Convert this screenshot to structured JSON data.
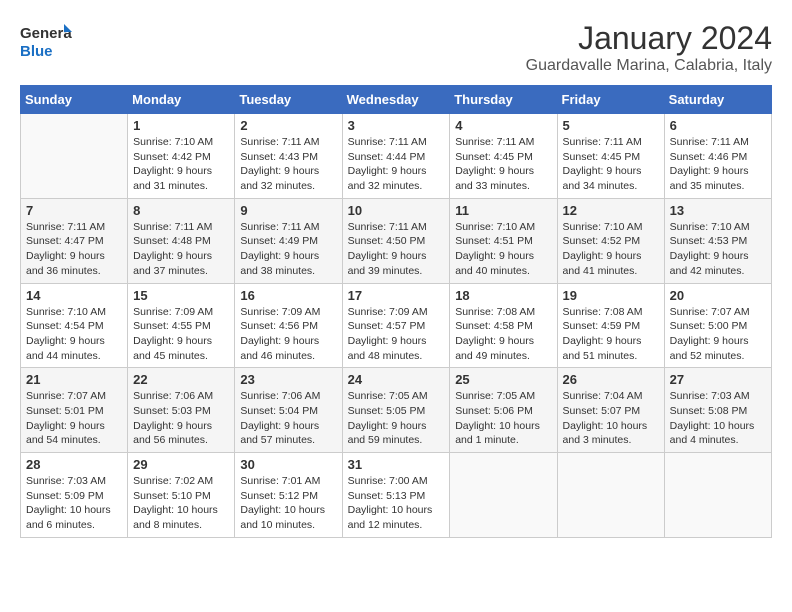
{
  "logo": {
    "general": "General",
    "blue": "Blue"
  },
  "header": {
    "month": "January 2024",
    "location": "Guardavalle Marina, Calabria, Italy"
  },
  "weekdays": [
    "Sunday",
    "Monday",
    "Tuesday",
    "Wednesday",
    "Thursday",
    "Friday",
    "Saturday"
  ],
  "weeks": [
    [
      {
        "day": "",
        "info": ""
      },
      {
        "day": "1",
        "info": "Sunrise: 7:10 AM\nSunset: 4:42 PM\nDaylight: 9 hours\nand 31 minutes."
      },
      {
        "day": "2",
        "info": "Sunrise: 7:11 AM\nSunset: 4:43 PM\nDaylight: 9 hours\nand 32 minutes."
      },
      {
        "day": "3",
        "info": "Sunrise: 7:11 AM\nSunset: 4:44 PM\nDaylight: 9 hours\nand 32 minutes."
      },
      {
        "day": "4",
        "info": "Sunrise: 7:11 AM\nSunset: 4:45 PM\nDaylight: 9 hours\nand 33 minutes."
      },
      {
        "day": "5",
        "info": "Sunrise: 7:11 AM\nSunset: 4:45 PM\nDaylight: 9 hours\nand 34 minutes."
      },
      {
        "day": "6",
        "info": "Sunrise: 7:11 AM\nSunset: 4:46 PM\nDaylight: 9 hours\nand 35 minutes."
      }
    ],
    [
      {
        "day": "7",
        "info": "Sunrise: 7:11 AM\nSunset: 4:47 PM\nDaylight: 9 hours\nand 36 minutes."
      },
      {
        "day": "8",
        "info": "Sunrise: 7:11 AM\nSunset: 4:48 PM\nDaylight: 9 hours\nand 37 minutes."
      },
      {
        "day": "9",
        "info": "Sunrise: 7:11 AM\nSunset: 4:49 PM\nDaylight: 9 hours\nand 38 minutes."
      },
      {
        "day": "10",
        "info": "Sunrise: 7:11 AM\nSunset: 4:50 PM\nDaylight: 9 hours\nand 39 minutes."
      },
      {
        "day": "11",
        "info": "Sunrise: 7:10 AM\nSunset: 4:51 PM\nDaylight: 9 hours\nand 40 minutes."
      },
      {
        "day": "12",
        "info": "Sunrise: 7:10 AM\nSunset: 4:52 PM\nDaylight: 9 hours\nand 41 minutes."
      },
      {
        "day": "13",
        "info": "Sunrise: 7:10 AM\nSunset: 4:53 PM\nDaylight: 9 hours\nand 42 minutes."
      }
    ],
    [
      {
        "day": "14",
        "info": "Sunrise: 7:10 AM\nSunset: 4:54 PM\nDaylight: 9 hours\nand 44 minutes."
      },
      {
        "day": "15",
        "info": "Sunrise: 7:09 AM\nSunset: 4:55 PM\nDaylight: 9 hours\nand 45 minutes."
      },
      {
        "day": "16",
        "info": "Sunrise: 7:09 AM\nSunset: 4:56 PM\nDaylight: 9 hours\nand 46 minutes."
      },
      {
        "day": "17",
        "info": "Sunrise: 7:09 AM\nSunset: 4:57 PM\nDaylight: 9 hours\nand 48 minutes."
      },
      {
        "day": "18",
        "info": "Sunrise: 7:08 AM\nSunset: 4:58 PM\nDaylight: 9 hours\nand 49 minutes."
      },
      {
        "day": "19",
        "info": "Sunrise: 7:08 AM\nSunset: 4:59 PM\nDaylight: 9 hours\nand 51 minutes."
      },
      {
        "day": "20",
        "info": "Sunrise: 7:07 AM\nSunset: 5:00 PM\nDaylight: 9 hours\nand 52 minutes."
      }
    ],
    [
      {
        "day": "21",
        "info": "Sunrise: 7:07 AM\nSunset: 5:01 PM\nDaylight: 9 hours\nand 54 minutes."
      },
      {
        "day": "22",
        "info": "Sunrise: 7:06 AM\nSunset: 5:03 PM\nDaylight: 9 hours\nand 56 minutes."
      },
      {
        "day": "23",
        "info": "Sunrise: 7:06 AM\nSunset: 5:04 PM\nDaylight: 9 hours\nand 57 minutes."
      },
      {
        "day": "24",
        "info": "Sunrise: 7:05 AM\nSunset: 5:05 PM\nDaylight: 9 hours\nand 59 minutes."
      },
      {
        "day": "25",
        "info": "Sunrise: 7:05 AM\nSunset: 5:06 PM\nDaylight: 10 hours\nand 1 minute."
      },
      {
        "day": "26",
        "info": "Sunrise: 7:04 AM\nSunset: 5:07 PM\nDaylight: 10 hours\nand 3 minutes."
      },
      {
        "day": "27",
        "info": "Sunrise: 7:03 AM\nSunset: 5:08 PM\nDaylight: 10 hours\nand 4 minutes."
      }
    ],
    [
      {
        "day": "28",
        "info": "Sunrise: 7:03 AM\nSunset: 5:09 PM\nDaylight: 10 hours\nand 6 minutes."
      },
      {
        "day": "29",
        "info": "Sunrise: 7:02 AM\nSunset: 5:10 PM\nDaylight: 10 hours\nand 8 minutes."
      },
      {
        "day": "30",
        "info": "Sunrise: 7:01 AM\nSunset: 5:12 PM\nDaylight: 10 hours\nand 10 minutes."
      },
      {
        "day": "31",
        "info": "Sunrise: 7:00 AM\nSunset: 5:13 PM\nDaylight: 10 hours\nand 12 minutes."
      },
      {
        "day": "",
        "info": ""
      },
      {
        "day": "",
        "info": ""
      },
      {
        "day": "",
        "info": ""
      }
    ]
  ]
}
